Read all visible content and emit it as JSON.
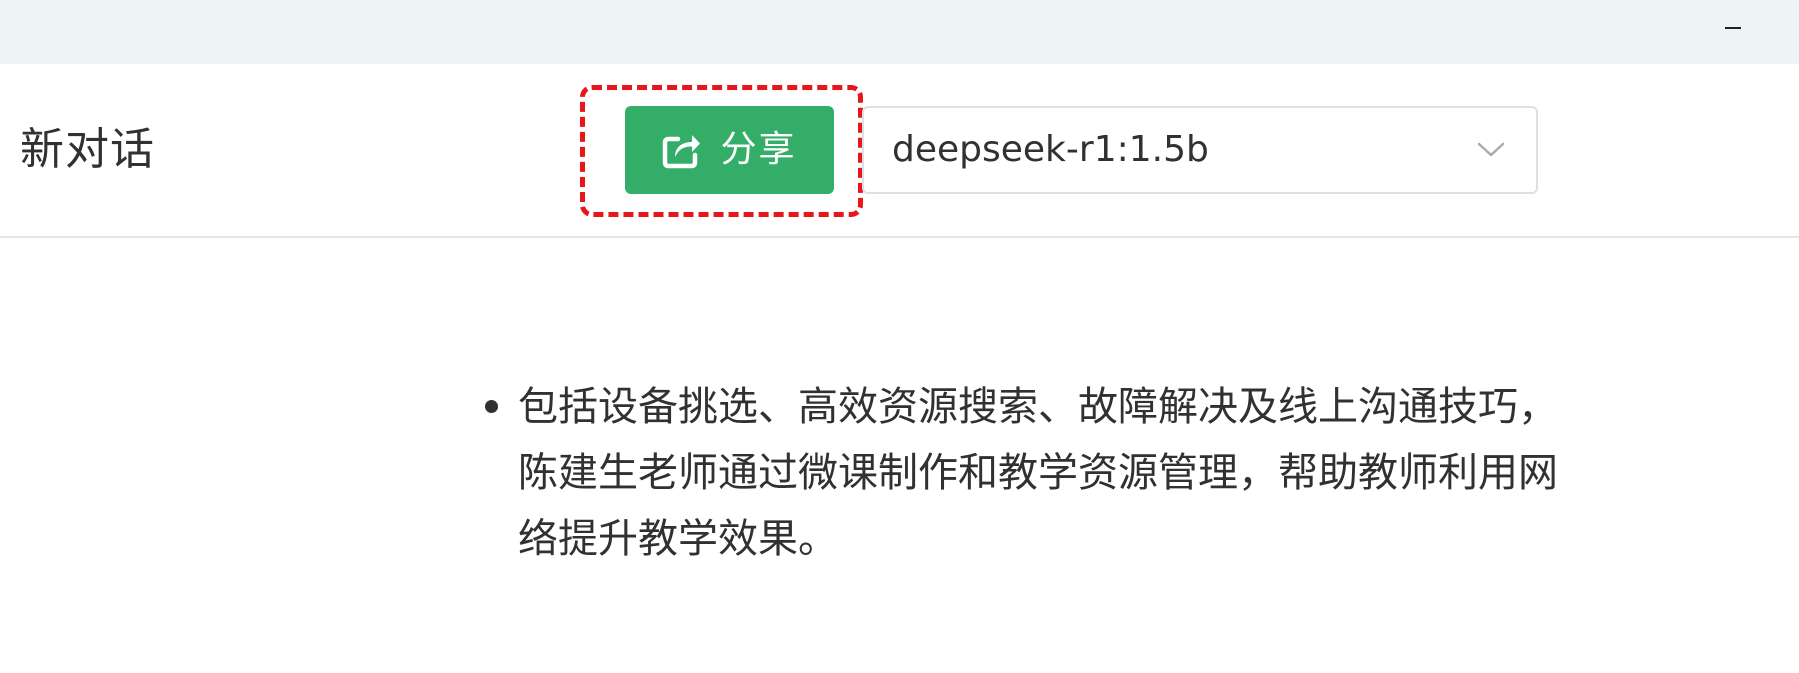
{
  "titlebar": {
    "minimize_icon": "minimize-icon"
  },
  "header": {
    "title": "新对话",
    "share_button": {
      "label": "分享",
      "icon": "share-icon",
      "color": "#34ad68"
    },
    "highlight_color": "#e8151c",
    "model_select": {
      "value": "deepseek-r1:1.5b",
      "icon": "chevron-down-icon"
    }
  },
  "content": {
    "list_items": [
      {
        "text": "包括设备挑选、高效资源搜索、故障解决及线上沟通技巧，陈建生老师通过微课制作和教学资源管理，帮助教师利用网络提升教学效果。"
      }
    ]
  }
}
